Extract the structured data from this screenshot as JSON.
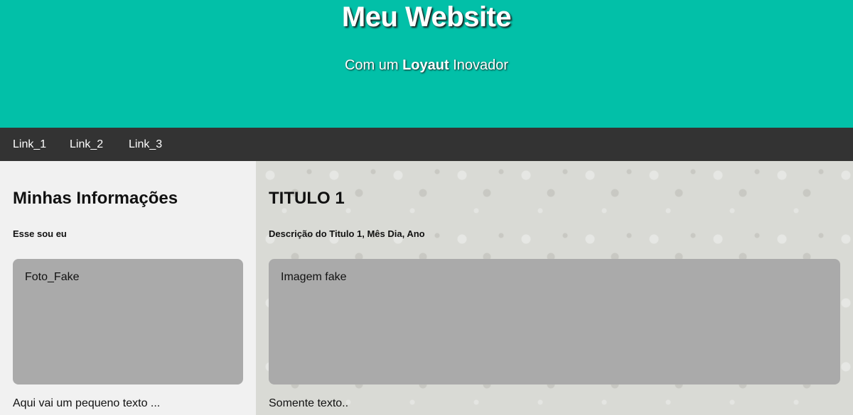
{
  "header": {
    "title": "Meu Website",
    "subtitle_before": "Com um ",
    "subtitle_bold": "Loyaut",
    "subtitle_after": " Inovador"
  },
  "nav": {
    "links": [
      "Link_1",
      "Link_2",
      "Link_3"
    ]
  },
  "left": {
    "heading": "Minhas Informações",
    "subheading": "Esse sou eu",
    "image_label": "Foto_Fake",
    "text": "Aqui vai um pequeno texto ..."
  },
  "right": {
    "heading": "TITULO 1",
    "subheading": "Descrição do Titulo 1, Mês Dia, Ano",
    "image_label": "Imagem fake",
    "text": "Somente texto.."
  },
  "colors": {
    "header_bg": "#02c0a8",
    "nav_bg": "#333333",
    "left_bg": "#f1f1f1",
    "image_placeholder": "#aaaaaa"
  }
}
